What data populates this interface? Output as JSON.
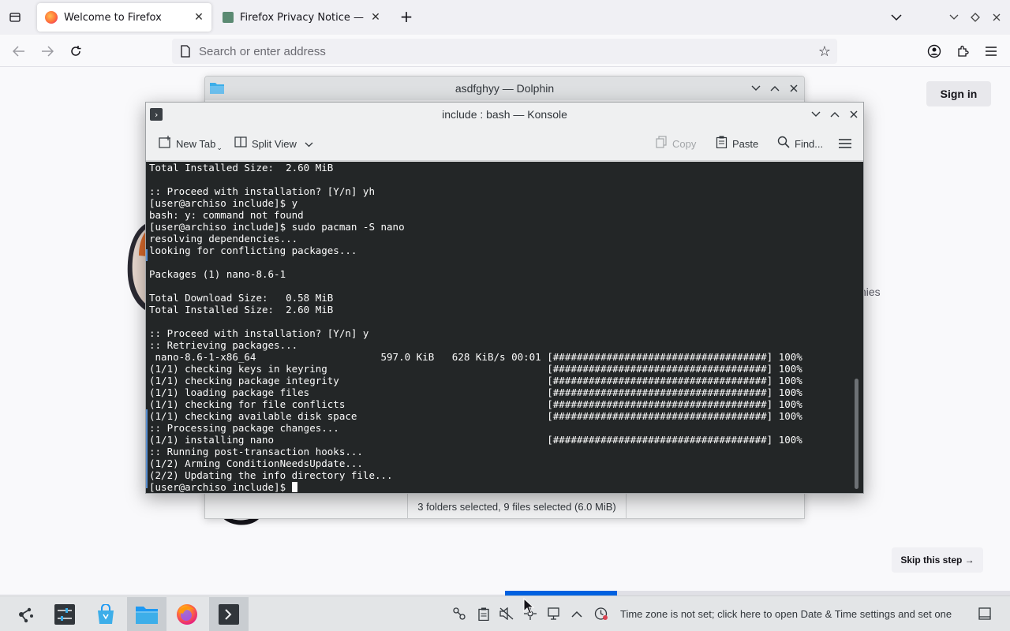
{
  "firefox": {
    "tabs": [
      {
        "title": "Welcome to Firefox",
        "active": true
      },
      {
        "title": "Firefox Privacy Notice — M",
        "active": false
      }
    ],
    "new_tab_symbol": "+",
    "address_placeholder": "Search or enter address",
    "content": {
      "sign_in_label": "Sign in",
      "partial_text": "hies",
      "skip_label": "Skip this step →",
      "onboarding_progress_fraction": 0.222
    },
    "icons": {
      "tab_list": "list-all-tabs-icon",
      "back": "back-arrow-icon",
      "forward": "forward-arrow-icon",
      "reload": "reload-icon",
      "bookmark": "star-icon",
      "account": "account-icon",
      "extensions": "puzzle-icon",
      "menu": "hamburger-icon"
    }
  },
  "dolphin": {
    "title": "asdfghyy — Dolphin",
    "status": "3 folders selected, 9 files selected (6.0 MiB)"
  },
  "konsole": {
    "title": "include : bash — Konsole",
    "toolbar": {
      "new_tab": "New Tab",
      "split_view": "Split View",
      "copy": "Copy",
      "paste": "Paste",
      "find": "Find..."
    },
    "terminal_lines": [
      "Total Installed Size:  2.60 MiB",
      "",
      ":: Proceed with installation? [Y/n] yh",
      "[user@archiso include]$ y",
      "bash: y: command not found",
      "[user@archiso include]$ sudo pacman -S nano",
      "resolving dependencies...",
      "looking for conflicting packages...",
      "",
      "Packages (1) nano-8.6-1",
      "",
      "Total Download Size:   0.58 MiB",
      "Total Installed Size:  2.60 MiB",
      "",
      ":: Proceed with installation? [Y/n] y",
      ":: Retrieving packages...",
      " nano-8.6-1-x86_64                     597.0 KiB   628 KiB/s 00:01 [####################################] 100%",
      "(1/1) checking keys in keyring                                     [####################################] 100%",
      "(1/1) checking package integrity                                   [####################################] 100%",
      "(1/1) loading package files                                        [####################################] 100%",
      "(1/1) checking for file conflicts                                  [####################################] 100%",
      "(1/1) checking available disk space                                [####################################] 100%",
      ":: Processing package changes...",
      "(1/1) installing nano                                              [####################################] 100%",
      ":: Running post-transaction hooks...",
      "(1/2) Arming ConditionNeedsUpdate...",
      "(2/2) Updating the info directory file..."
    ],
    "prompt": "[user@archiso include]$ "
  },
  "taskbar": {
    "apps": [
      {
        "name": "application-launcher-icon",
        "active": false
      },
      {
        "name": "system-settings-icon",
        "active": false
      },
      {
        "name": "discover-store-icon",
        "active": false
      },
      {
        "name": "dolphin-folder-icon",
        "active": true
      },
      {
        "name": "firefox-icon",
        "active": false
      },
      {
        "name": "konsole-icon",
        "active": true
      }
    ],
    "tray_message": "Time zone is not set; click here to open Date & Time settings and set one"
  },
  "colors": {
    "terminal_bg": "#232627",
    "terminal_fg": "#fcfcfc",
    "accent_blue": "#0061e0",
    "taskbar_bg": "#e3e5e7"
  }
}
